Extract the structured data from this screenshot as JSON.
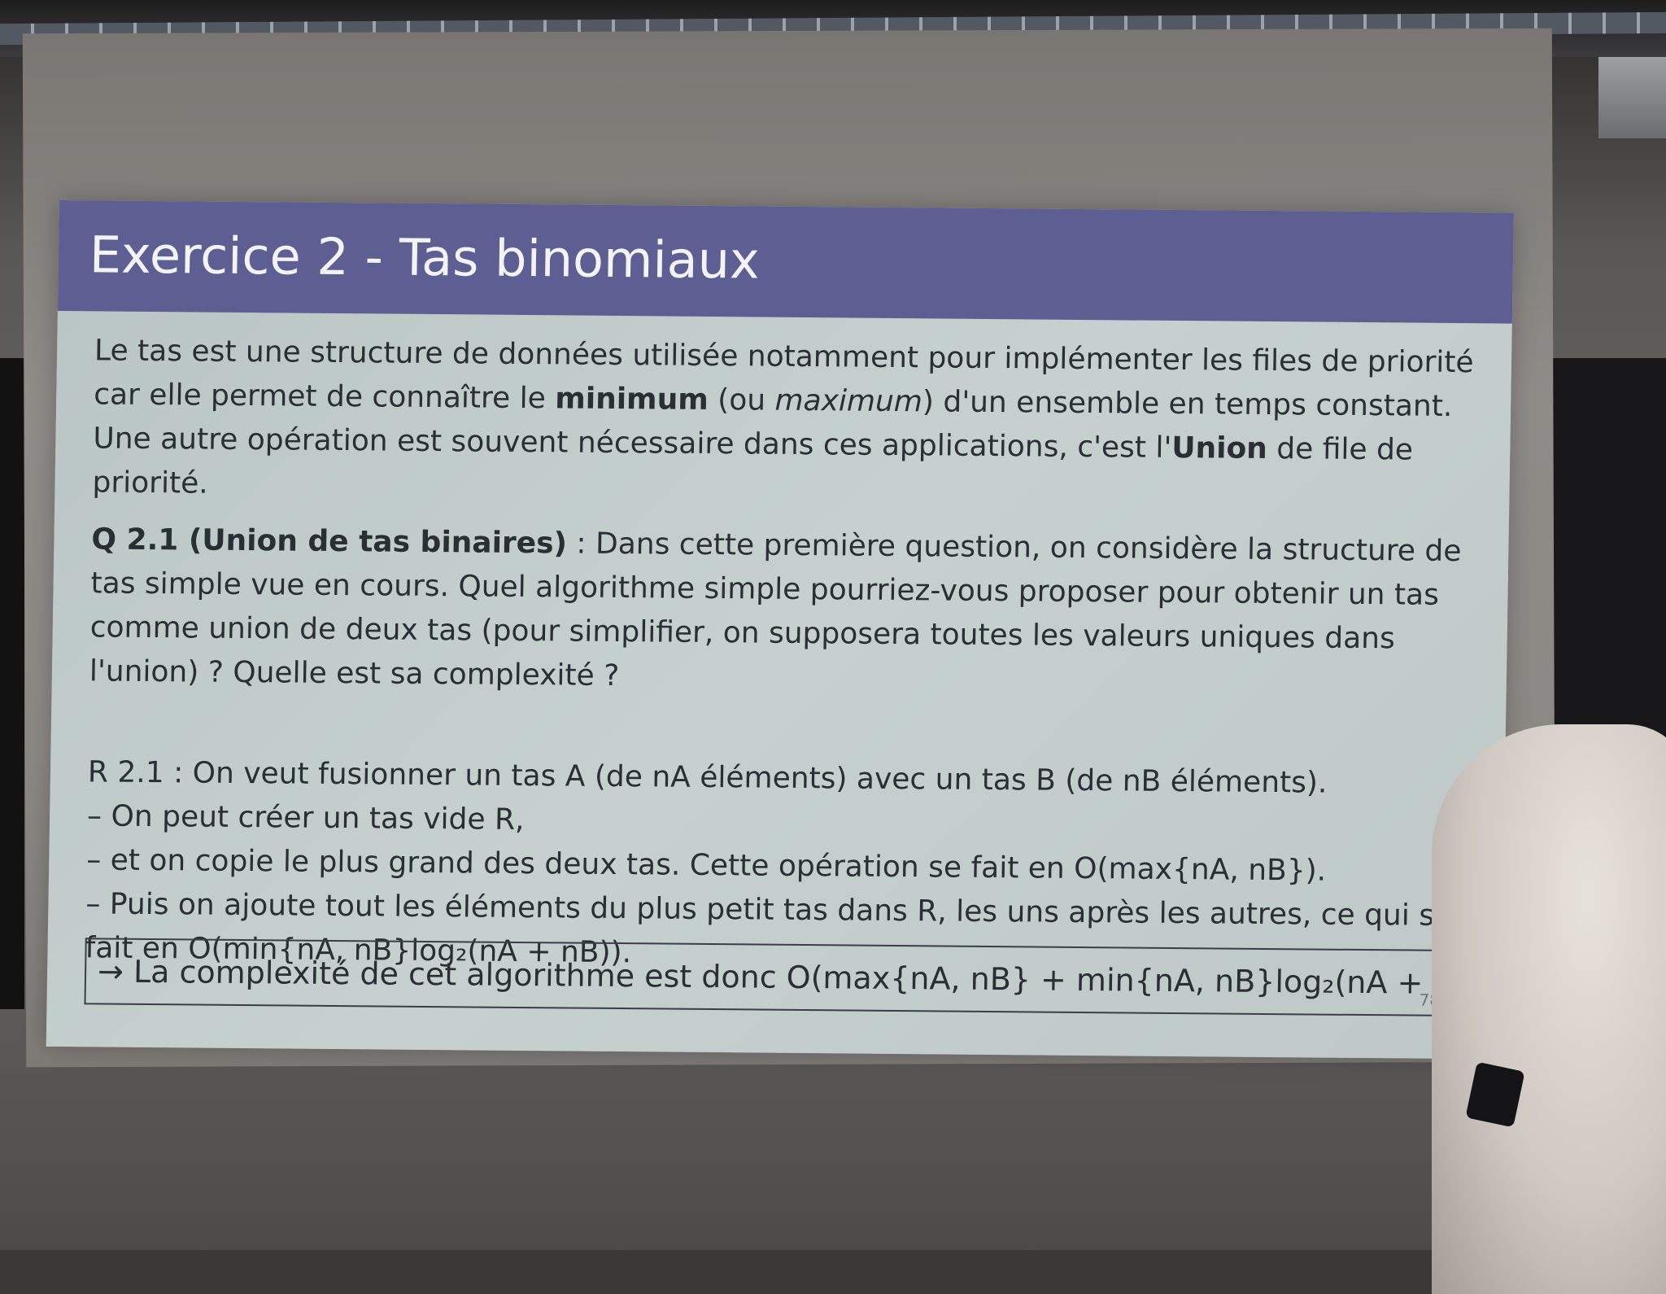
{
  "slide": {
    "title": "Exercice 2 - Tas binomiaux",
    "intro": {
      "p1": "Le tas est une structure de données utilisée notamment pour implémenter les files de priorité car elle permet de connaître le ",
      "minimum": "minimum",
      "p2": " (ou ",
      "maximum": "maximum",
      "p3": ") d'un ensemble en temps constant. Une autre opération est souvent nécessaire dans ces applications, c'est l'",
      "union": "Union",
      "p4": " de file de priorité."
    },
    "question": {
      "label": "Q 2.1 (Union de tas binaires)",
      "text": " : Dans cette première question, on considère la structure de tas simple vue en cours. Quel algorithme simple pourriez-vous proposer pour obtenir un tas comme union de deux tas (pour simplifier, on supposera toutes les valeurs uniques dans l'union) ? Quelle est sa complexité ?"
    },
    "answer": {
      "label": "R 2.1",
      "line1": " : On veut fusionner un tas A (de nA éléments) avec un tas B (de nB éléments).",
      "line2": "– On peut créer un tas vide R,",
      "line3": "– et on copie le plus grand des deux tas. Cette opération se fait en O(max{nA, nB}).",
      "line4": "– Puis on ajoute tout les éléments du plus petit tas dans R, les uns après les autres, ce qui se",
      "line5": "fait en O(min{nA, nB}log₂(nA + nB))."
    },
    "conclusion": "→ La complexité de cet algorithme est donc O(max{nA, nB} + min{nA, nB}log₂(nA + nB)).",
    "page": "78 / 141"
  },
  "colors": {
    "title_bar": "#5d5f92",
    "slide_bg": "#c2cdcb",
    "text": "#2a2f33"
  }
}
